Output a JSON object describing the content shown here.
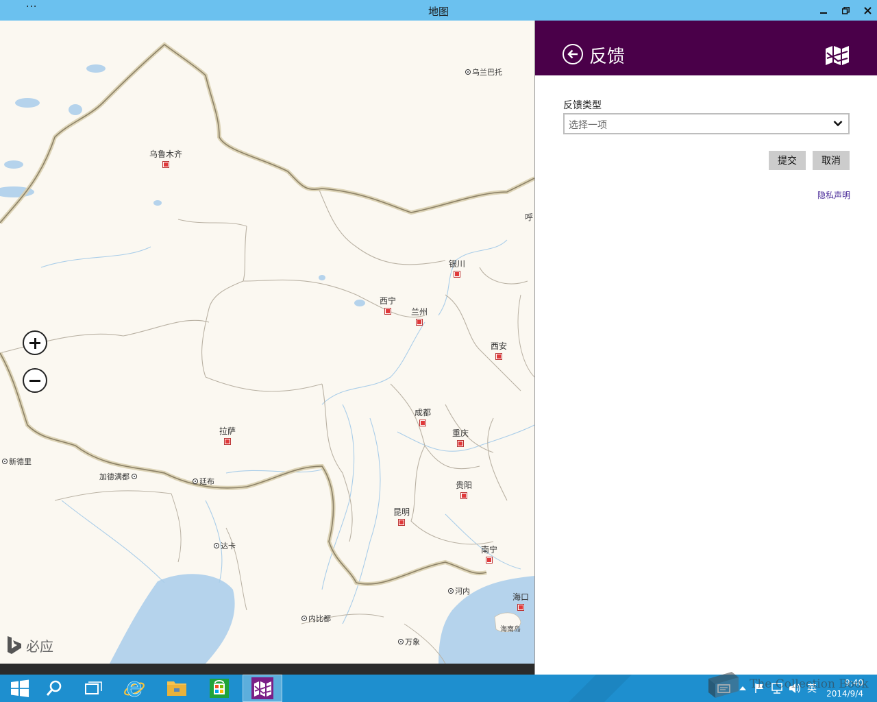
{
  "window": {
    "title": "地图",
    "menu_glyph": "···"
  },
  "map": {
    "capitals": [
      {
        "name": "乌鲁木齐"
      },
      {
        "name": "银川"
      },
      {
        "name": "西宁"
      },
      {
        "name": "兰州"
      },
      {
        "name": "西安"
      },
      {
        "name": "成都"
      },
      {
        "name": "重庆"
      },
      {
        "name": "拉萨"
      },
      {
        "name": "贵阳"
      },
      {
        "name": "昆明"
      },
      {
        "name": "南宁"
      },
      {
        "name": "海口"
      }
    ],
    "foreign_cities": [
      {
        "name": "乌兰巴托"
      },
      {
        "name": "新德里"
      },
      {
        "name": "加德满都"
      },
      {
        "name": "廷布"
      },
      {
        "name": "达卡"
      },
      {
        "name": "河内"
      },
      {
        "name": "内比都"
      },
      {
        "name": "万象"
      }
    ],
    "edge_label": "呼",
    "island_label": "海南岛",
    "bing_label": "必应"
  },
  "feedback": {
    "title": "反馈",
    "type_label": "反馈类型",
    "select_placeholder": "选择一项",
    "submit_label": "提交",
    "cancel_label": "取消",
    "privacy_label": "隐私声明"
  },
  "taskbar": {
    "ime": "英",
    "time": "9:40",
    "date": "2014/9/4"
  },
  "watermark": "The Collection Book"
}
